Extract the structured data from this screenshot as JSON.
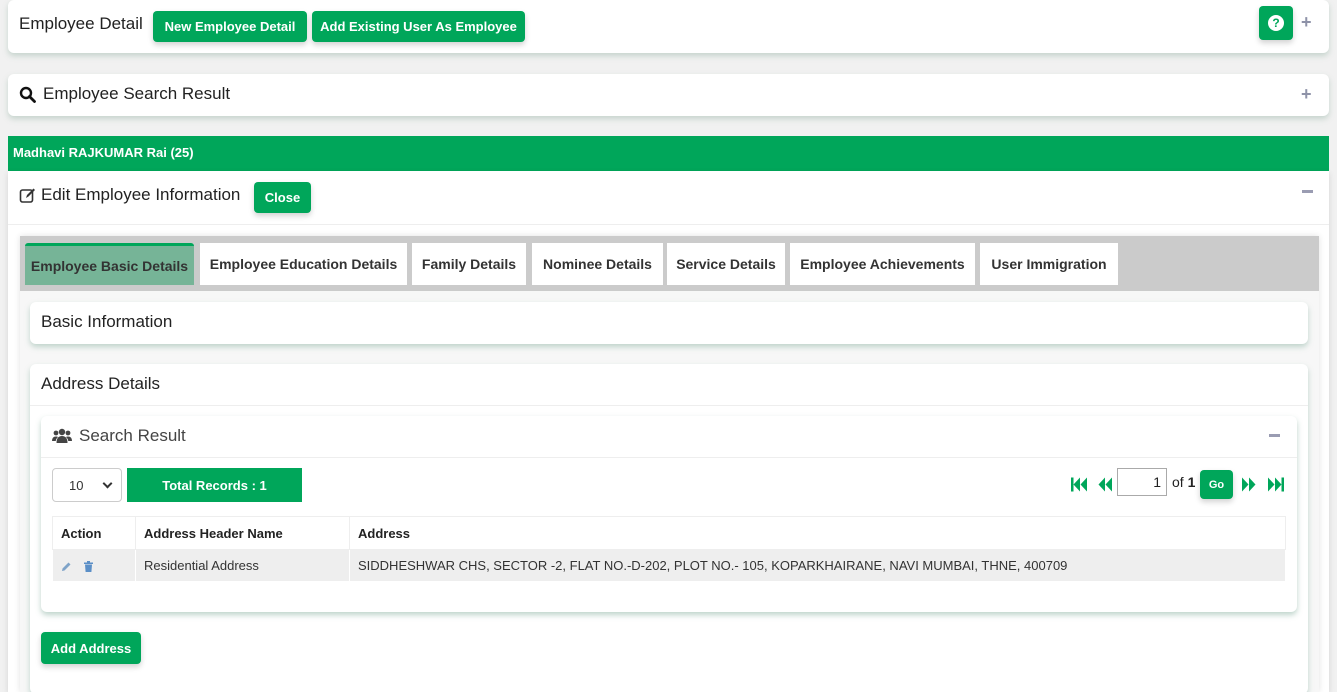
{
  "header": {
    "title": "Employee Detail",
    "new_button": "New Employee Detail",
    "add_existing_button": "Add Existing User As Employee",
    "help_icon": "?",
    "expand_icon": "+"
  },
  "search_panel": {
    "title": "Employee Search Result",
    "expand_icon": "+"
  },
  "employee_bar": {
    "name": "Madhavi RAJKUMAR Rai (25)"
  },
  "edit_panel": {
    "title": "Edit Employee Information",
    "close_button": "Close",
    "collapse_icon": "−"
  },
  "tabs": [
    {
      "label": "Employee Basic Details",
      "active": true
    },
    {
      "label": "Employee Education Details",
      "active": false
    },
    {
      "label": "Family Details",
      "active": false
    },
    {
      "label": "Nominee Details",
      "active": false
    },
    {
      "label": "Service Details",
      "active": false
    },
    {
      "label": "Employee Achievements",
      "active": false
    },
    {
      "label": "User Immigration",
      "active": false
    }
  ],
  "basic_info": {
    "title": "Basic Information"
  },
  "address_details": {
    "title": "Address Details",
    "search_result": {
      "title": "Search Result",
      "page_size": "10",
      "total_records": "Total Records : 1",
      "current_page": "1",
      "of_label": "of",
      "total_pages": "1",
      "go_button": "Go",
      "columns": [
        "Action",
        "Address Header Name",
        "Address"
      ],
      "rows": [
        {
          "header_name": "Residential Address",
          "address": "SIDDHESHWAR CHS, SECTOR -2, FLAT NO.-D-202, PLOT NO.- 105, KOPARKHAIRANE, NAVI MUMBAI, THNE, 400709"
        }
      ]
    },
    "add_button": "Add Address"
  },
  "colors": {
    "primary_green": "#00a65a",
    "active_tab": "#76b497",
    "tabbar_bg": "#cbcbcb"
  }
}
